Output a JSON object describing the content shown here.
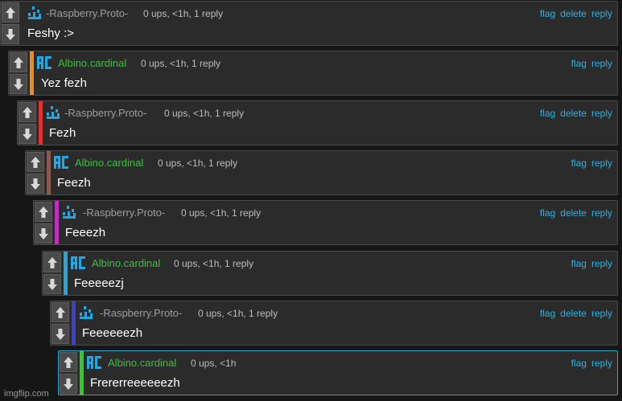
{
  "comments": [
    {
      "username": "-Raspberry.Proto-",
      "meta": "0 ups, <1h, 1 reply",
      "body": "Feshy :>",
      "actions": [
        "flag",
        "delete",
        "reply"
      ],
      "user_color": "#9e9e9e",
      "accent_color": "",
      "avatar": "rp-icon"
    },
    {
      "username": "Albino.cardinal",
      "meta": "0 ups, <1h, 1 reply",
      "body": "Yez fezh",
      "actions": [
        "flag",
        "reply"
      ],
      "user_color": "#3fbf3f",
      "accent_color": "#f08a1c",
      "avatar": "ac-icon"
    },
    {
      "username": "-Raspberry.Proto-",
      "meta": "0 ups, <1h, 1 reply",
      "body": "Fezh",
      "actions": [
        "flag",
        "delete",
        "reply"
      ],
      "user_color": "#9e9e9e",
      "accent_color": "#e03030",
      "avatar": "rp-icon"
    },
    {
      "username": "Albino.cardinal",
      "meta": "0 ups, <1h, 1 reply",
      "body": "Feezh",
      "actions": [
        "flag",
        "reply"
      ],
      "user_color": "#3fbf3f",
      "accent_color": "#8a5a50",
      "avatar": "ac-icon"
    },
    {
      "username": "-Raspberry.Proto-",
      "meta": "0 ups, <1h, 1 reply",
      "body": "Feeezh",
      "actions": [
        "flag",
        "delete",
        "reply"
      ],
      "user_color": "#9e9e9e",
      "accent_color": "#c030c0",
      "avatar": "rp-icon"
    },
    {
      "username": "Albino.cardinal",
      "meta": "0 ups, <1h, 1 reply",
      "body": "Feeeeezj",
      "actions": [
        "flag",
        "reply"
      ],
      "user_color": "#3fbf3f",
      "accent_color": "#2aa3d8",
      "avatar": "ac-icon"
    },
    {
      "username": "-Raspberry.Proto-",
      "meta": "0 ups, <1h, 1 reply",
      "body": "Feeeeeezh",
      "actions": [
        "flag",
        "delete",
        "reply"
      ],
      "user_color": "#9e9e9e",
      "accent_color": "#4040d0",
      "avatar": "rp-icon"
    },
    {
      "username": "Albino.cardinal",
      "meta": "0 ups, <1h",
      "body": "Frererreeeeeezh",
      "actions": [
        "flag",
        "reply"
      ],
      "user_color": "#3fbf3f",
      "accent_color": "#28d028",
      "avatar": "ac-icon"
    }
  ],
  "colors": {
    "link": "#29b3e6",
    "avatar": "#1fa9e6",
    "highlight_border": "#2ea5c9"
  },
  "icons": {
    "up": "arrow-up-icon",
    "down": "arrow-down-icon"
  },
  "watermark": "imgflip.com"
}
